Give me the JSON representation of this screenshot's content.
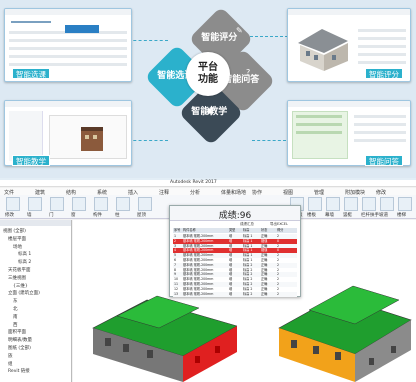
{
  "hub": {
    "center_line1": "平台",
    "center_line2": "功能",
    "arms": [
      "智能评分",
      "智能问答",
      "智能教学",
      "智能选课"
    ]
  },
  "cards": [
    {
      "tag": "智能选课"
    },
    {
      "tag": "智能评分"
    },
    {
      "tag": "智能教学"
    },
    {
      "tag": "智能问答"
    }
  ],
  "revit": {
    "title": "Autodesk Revit 2017",
    "menu": [
      "文件",
      "建筑",
      "结构",
      "系统",
      "插入",
      "注释",
      "分析",
      "体量和场地",
      "协作",
      "视图",
      "管理",
      "附加模块",
      "修改"
    ],
    "ribbon": [
      "修改",
      "墙",
      "门",
      "窗",
      "构件",
      "柱",
      "屋顶",
      "天花板",
      "楼板",
      "幕墙",
      "竖梃",
      "栏杆扶手",
      "坡道",
      "楼梯"
    ],
    "tree": [
      "视图 (全部)",
      "楼层平面",
      "场地",
      "标高 1",
      "标高 2",
      "天花板平面",
      "三维视图",
      "{三维}",
      "立面 (建筑立面)",
      "东",
      "北",
      "南",
      "西",
      "面积平面",
      "明细表/数量",
      "图纸 (全部)",
      "族",
      "组",
      "Revit 链接"
    ]
  },
  "grade": {
    "title": "成绩:96",
    "toolbar": [
      "成绩汇总",
      "导出EXCEL"
    ],
    "headers": [
      "序号",
      "构件名称",
      "类型",
      "标高",
      "状态",
      "得分"
    ],
    "rows": [
      {
        "n": "1",
        "name": "基本墙 常规-200mm",
        "type": "墙",
        "lv": "标高 1",
        "st": "正确",
        "sc": "2",
        "bad": false
      },
      {
        "n": "2",
        "name": "基本墙 常规-200mm",
        "type": "墙",
        "lv": "标高 1",
        "st": "错误",
        "sc": "0",
        "bad": true
      },
      {
        "n": "3",
        "name": "基本墙 常规-200mm",
        "type": "墙",
        "lv": "标高 1",
        "st": "正确",
        "sc": "2",
        "bad": false
      },
      {
        "n": "4",
        "name": "基本墙 常规-200mm",
        "type": "墙",
        "lv": "标高 1",
        "st": "错误",
        "sc": "0",
        "bad": true
      },
      {
        "n": "5",
        "name": "基本墙 常规-200mm",
        "type": "墙",
        "lv": "标高 1",
        "st": "正确",
        "sc": "2",
        "bad": false
      },
      {
        "n": "6",
        "name": "基本墙 常规-200mm",
        "type": "墙",
        "lv": "标高 1",
        "st": "正确",
        "sc": "2",
        "bad": false
      },
      {
        "n": "7",
        "name": "基本墙 常规-200mm",
        "type": "墙",
        "lv": "标高 2",
        "st": "正确",
        "sc": "2",
        "bad": false
      },
      {
        "n": "8",
        "name": "基本墙 常规-200mm",
        "type": "墙",
        "lv": "标高 2",
        "st": "正确",
        "sc": "2",
        "bad": false
      },
      {
        "n": "9",
        "name": "基本墙 常规-200mm",
        "type": "墙",
        "lv": "标高 2",
        "st": "正确",
        "sc": "2",
        "bad": false
      },
      {
        "n": "10",
        "name": "基本墙 常规-200mm",
        "type": "墙",
        "lv": "标高 2",
        "st": "正确",
        "sc": "2",
        "bad": false
      },
      {
        "n": "11",
        "name": "基本墙 常规-200mm",
        "type": "墙",
        "lv": "标高 2",
        "st": "正确",
        "sc": "2",
        "bad": false
      },
      {
        "n": "12",
        "name": "基本墙 常规-200mm",
        "type": "墙",
        "lv": "标高 2",
        "st": "正确",
        "sc": "2",
        "bad": false
      },
      {
        "n": "13",
        "name": "基本墙 常规-200mm",
        "type": "墙",
        "lv": "标高 2",
        "st": "正确",
        "sc": "2",
        "bad": false
      }
    ]
  },
  "colors": {
    "teal": "#2bb1cc",
    "error_row": "#e03030",
    "roof": "#1f9e2e",
    "wall_red": "#e02020",
    "wall_orange": "#f2a21a"
  }
}
